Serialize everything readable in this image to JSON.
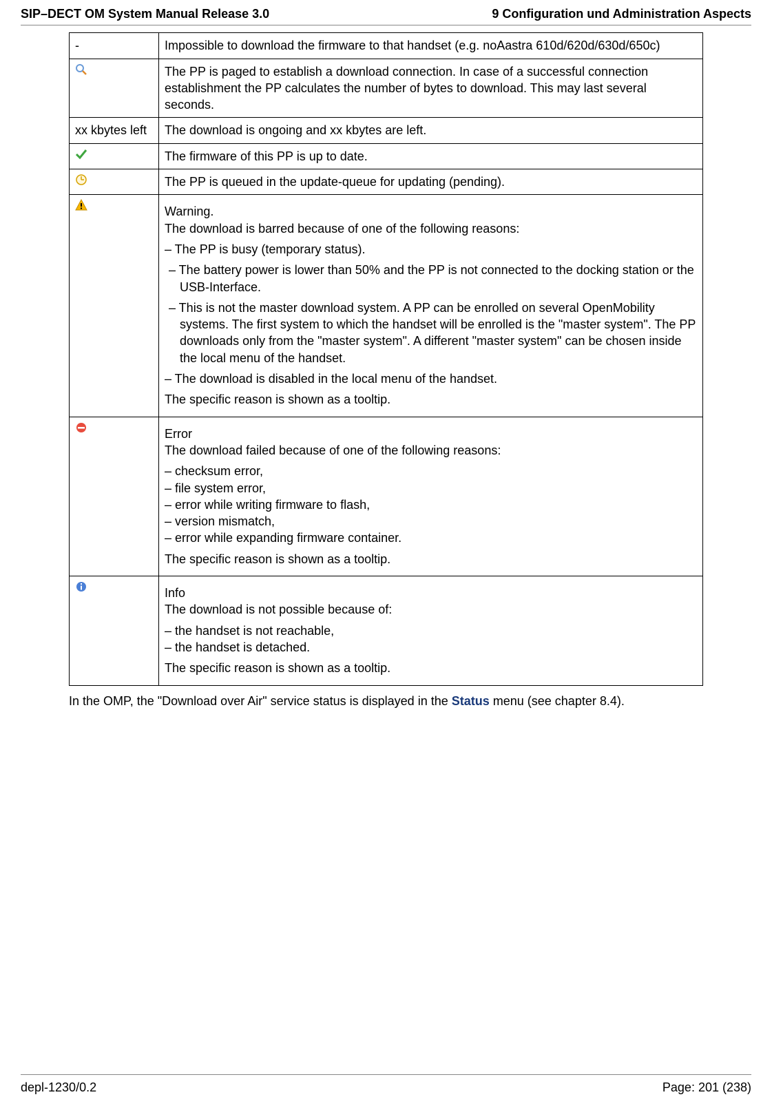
{
  "header": {
    "left": "SIP–DECT OM System Manual Release 3.0",
    "right": "9 Configuration und Administration Aspects"
  },
  "rows": {
    "r1": {
      "symbol": "-",
      "text": "Impossible to download the firmware to that handset (e.g. noAastra 610d/620d/630d/650c)"
    },
    "r2": {
      "text": "The PP is paged to establish a download connection. In case of a successful connection establishment the PP calculates the number of bytes to download. This may last several seconds."
    },
    "r3": {
      "symbol": "xx kbytes left",
      "text": "The download is ongoing and xx kbytes are left."
    },
    "r4": {
      "text": "The firmware of this PP is up to date."
    },
    "r5": {
      "text": "The PP is queued in the update-queue for updating (pending)."
    },
    "r6": {
      "title": "Warning.",
      "intro": "The download is barred because of one of the following reasons:",
      "b1": "– The PP is busy (temporary status).",
      "b2": "–  The battery power is lower than 50% and the PP is not connected to the docking station or the USB-Interface.",
      "b3": "–  This is not the master download system. A PP can be enrolled on several OpenMobility systems. The first system to which the handset will be enrolled is the \"master system\". The PP downloads only from the \"master system\". A different \"master system\" can be chosen inside the local menu of the handset.",
      "b4": "– The download is disabled in the local menu of the handset.",
      "tail": "The specific reason is shown as a tooltip."
    },
    "r7": {
      "title": "Error",
      "intro": "The download failed because of one of the following reasons:",
      "b1": "– checksum error,",
      "b2": "– file system error,",
      "b3": "– error while writing firmware to flash,",
      "b4": "– version mismatch,",
      "b5": "– error while expanding firmware container.",
      "tail": "The specific reason is shown as a tooltip."
    },
    "r8": {
      "title": "Info",
      "intro": "The download is not possible because of:",
      "b1": "– the handset is not reachable,",
      "b2": "– the handset is detached.",
      "tail": "The specific reason is shown as a tooltip."
    }
  },
  "after": {
    "pre": "In the OMP, the \"Download over Air\" service status is displayed in the ",
    "bold": "Status",
    "post": " menu (see chapter 8.4)."
  },
  "footer": {
    "left": "depl-1230/0.2",
    "right": "Page: 201 (238)"
  }
}
